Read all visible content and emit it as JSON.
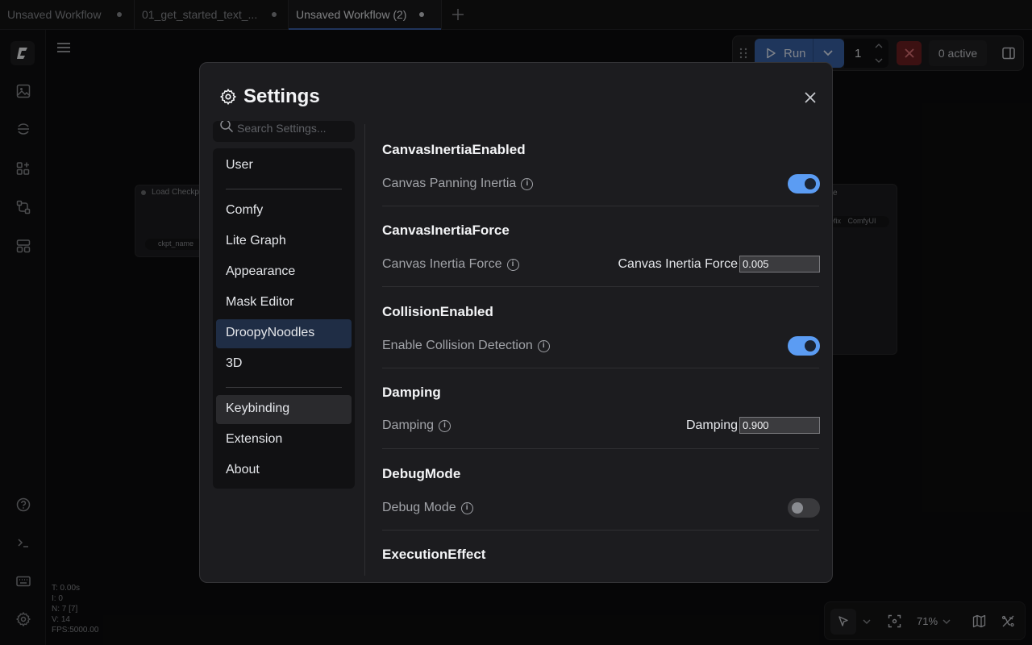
{
  "tabs": [
    {
      "label": "Unsaved Workflow",
      "active": false
    },
    {
      "label": "01_get_started_text_...",
      "active": false
    },
    {
      "label": "Unsaved Workflow (2)",
      "active": true
    }
  ],
  "canvas": {
    "node_left_title": "Load Checkp",
    "node_left_input": "ckpt_name",
    "node_right_title": "e",
    "node_right_label": "efix",
    "node_right_value": "ComfyUI",
    "stats": [
      "T: 0.00s",
      "I: 0",
      "N: 7 [7]",
      "V: 14",
      "FPS:5000.00"
    ]
  },
  "toolbar": {
    "run_label": "Run",
    "batch_count": "1",
    "active_label": "0 active"
  },
  "zoom": "71%",
  "settings": {
    "title": "Settings",
    "search_placeholder": "Search Settings...",
    "categories_group1": [
      "User"
    ],
    "categories_group2": [
      "Comfy",
      "Lite Graph",
      "Appearance",
      "Mask Editor",
      "DroopyNoodles",
      "3D"
    ],
    "categories_group3": [
      "Keybinding",
      "Extension",
      "About"
    ],
    "selected_category": "DroopyNoodles",
    "groups": [
      {
        "heading": "CanvasInertiaEnabled",
        "label": "Canvas Panning Inertia",
        "type": "toggle",
        "value": true
      },
      {
        "heading": "CanvasInertiaForce",
        "label": "Canvas Inertia Force",
        "type": "number",
        "field_label": "Canvas Inertia Force",
        "value": "0.005"
      },
      {
        "heading": "CollisionEnabled",
        "label": "Enable Collision Detection",
        "type": "toggle",
        "value": true
      },
      {
        "heading": "Damping",
        "label": "Damping",
        "type": "number",
        "field_label": "Damping",
        "value": "0.900"
      },
      {
        "heading": "DebugMode",
        "label": "Debug Mode",
        "type": "toggle",
        "value": false
      },
      {
        "heading": "ExecutionEffect"
      }
    ]
  },
  "colors": {
    "accent": "#5b9cf3",
    "run_button": "#3a63a8",
    "stop_button": "#6e1f22",
    "selected_category": "#1f2d45"
  }
}
